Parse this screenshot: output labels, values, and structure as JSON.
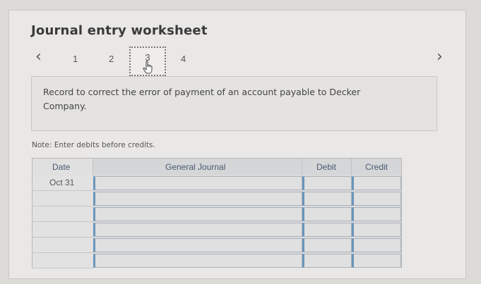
{
  "header": {
    "title": "Journal entry worksheet"
  },
  "nav": {
    "prev_icon": "chevron-left-icon",
    "next_icon": "chevron-right-icon",
    "steps": [
      "1",
      "2",
      "3",
      "4"
    ],
    "active_step": "3",
    "pointer_icon": "hand-pointer-icon"
  },
  "description": "Record to correct the error of payment of an account payable to Decker Company.",
  "note": "Note: Enter debits before credits.",
  "journal": {
    "columns": {
      "date": "Date",
      "general_journal": "General Journal",
      "debit": "Debit",
      "credit": "Credit"
    },
    "rows": [
      {
        "date": "Oct 31",
        "account": "",
        "debit": "",
        "credit": ""
      },
      {
        "date": "",
        "account": "",
        "debit": "",
        "credit": ""
      },
      {
        "date": "",
        "account": "",
        "debit": "",
        "credit": ""
      },
      {
        "date": "",
        "account": "",
        "debit": "",
        "credit": ""
      },
      {
        "date": "",
        "account": "",
        "debit": "",
        "credit": ""
      },
      {
        "date": "",
        "account": "",
        "debit": "",
        "credit": ""
      }
    ]
  },
  "colors": {
    "header_text": "#4a5a72",
    "input_accent": "#6b95b8"
  }
}
